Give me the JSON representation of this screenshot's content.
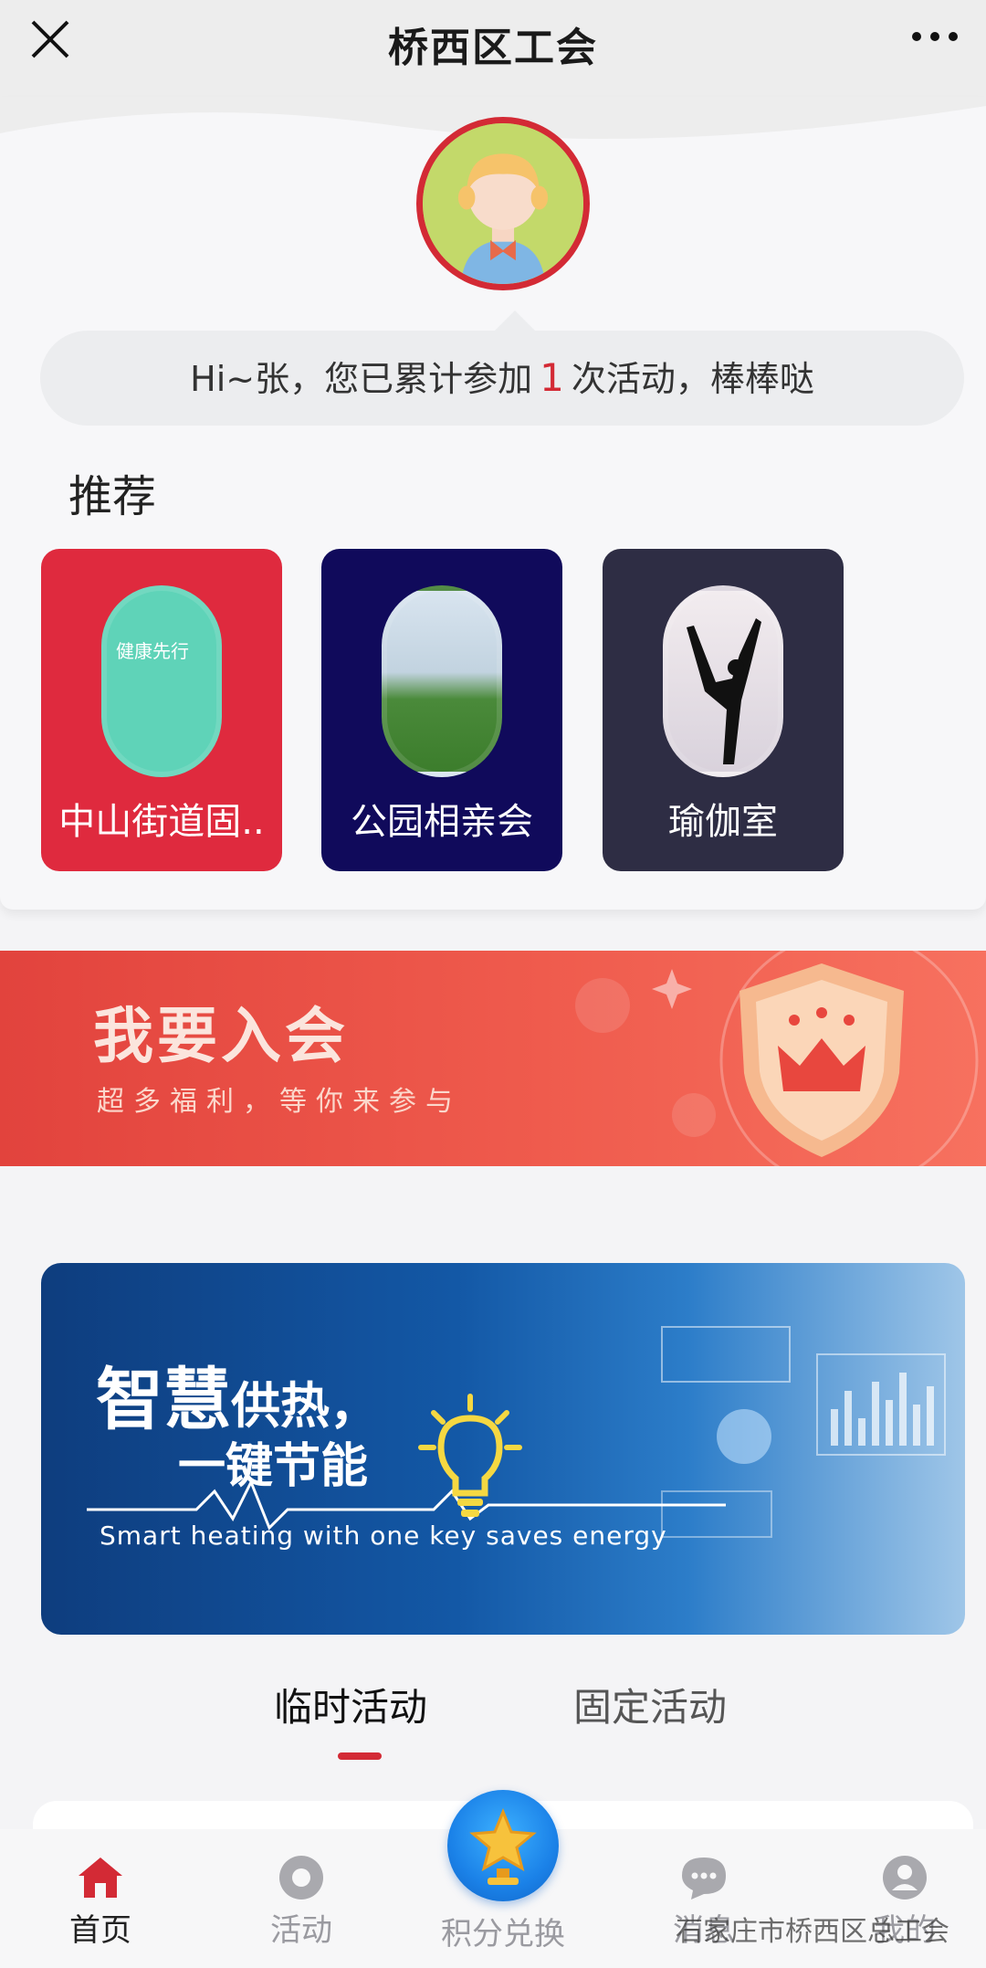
{
  "navbar": {
    "title": "桥西区工会"
  },
  "greeting": {
    "prefix": "Hi~张，您已累计参加",
    "count": "1",
    "suffix": "次活动，棒棒哒"
  },
  "recommend": {
    "title": "推荐",
    "items": [
      {
        "label": "中山街道固..",
        "image_text": "健康先行"
      },
      {
        "label": "公园相亲会"
      },
      {
        "label": "瑜伽室"
      }
    ]
  },
  "join_banner": {
    "title": "我要入会",
    "subtitle": "超多福利，等你来参与"
  },
  "heating_banner": {
    "title_big": "智慧",
    "title_small": "供热，",
    "title_line2": "一键节能",
    "english": "Smart heating with one key saves energy"
  },
  "tabs": {
    "temporary": "临时活动",
    "fixed": "固定活动",
    "active": "temporary"
  },
  "tabbar": {
    "home": "首页",
    "activity": "活动",
    "points": "积分兑换",
    "message": "消息",
    "mine": "我的"
  },
  "watermark": "石家庄市桥西区总工会",
  "colors": {
    "accent": "#d32a35",
    "join_banner": "#e84a42",
    "heating_banner": "#1358a6"
  }
}
